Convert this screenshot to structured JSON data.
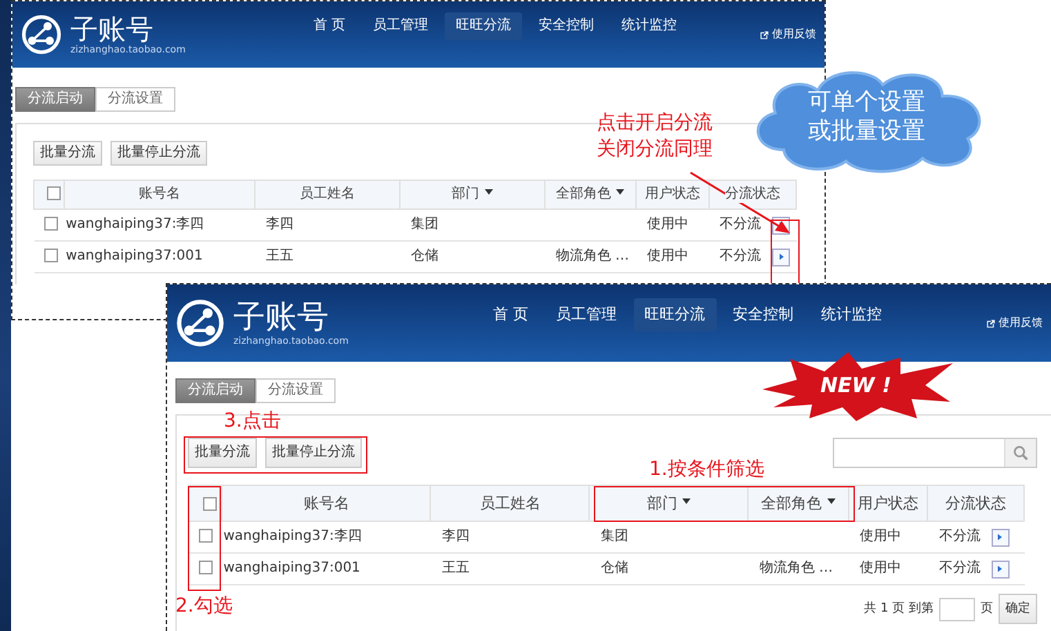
{
  "screens": [
    {
      "logo": {
        "title": "子账号",
        "subtitle": "zizhanghao.taobao.com"
      },
      "nav": [
        {
          "label": "首 页",
          "selected": false
        },
        {
          "label": "员工管理",
          "selected": false
        },
        {
          "label": "旺旺分流",
          "selected": true
        },
        {
          "label": "安全控制",
          "selected": false
        },
        {
          "label": "统计监控",
          "selected": false
        }
      ],
      "feedback": "使用反馈",
      "tabs": [
        {
          "label": "分流启动",
          "selected": true
        },
        {
          "label": "分流设置",
          "selected": false
        }
      ],
      "buttons": [
        "批量分流",
        "批量停止分流"
      ],
      "search": false,
      "table": {
        "header_checked": false,
        "columns": [
          {
            "label": "账号名",
            "dropdown": false
          },
          {
            "label": "员工姓名",
            "dropdown": false
          },
          {
            "label": "部门",
            "dropdown": true
          },
          {
            "label": "全部角色",
            "dropdown": true
          },
          {
            "label": "用户状态",
            "dropdown": false
          },
          {
            "label": "分流状态",
            "dropdown": false
          }
        ],
        "rows": [
          {
            "checked": false,
            "account": "wanghaiping37:李四",
            "name": "李四",
            "dept": "集团",
            "user_status": "使用中",
            "flow_status": "不分流"
          },
          {
            "checked": false,
            "account": "wanghaiping37:001",
            "name": "王五",
            "dept": "仓储",
            "role": "物流角色 …",
            "user_status": "使用中",
            "flow_status": "不分流"
          }
        ]
      }
    },
    {
      "logo": {
        "title": "子账号",
        "subtitle": "zizhanghao.taobao.com"
      },
      "nav": [
        {
          "label": "首 页",
          "selected": false
        },
        {
          "label": "员工管理",
          "selected": false
        },
        {
          "label": "旺旺分流",
          "selected": true
        },
        {
          "label": "安全控制",
          "selected": false
        },
        {
          "label": "统计监控",
          "selected": false
        }
      ],
      "feedback": "使用反馈",
      "tabs": [
        {
          "label": "分流启动",
          "selected": true
        },
        {
          "label": "分流设置",
          "selected": false
        }
      ],
      "buttons": [
        "批量分流",
        "批量停止分流"
      ],
      "search": true,
      "table": {
        "header_checked": false,
        "columns": [
          {
            "label": "账号名",
            "dropdown": false
          },
          {
            "label": "员工姓名",
            "dropdown": false
          },
          {
            "label": "部门",
            "dropdown": true
          },
          {
            "label": "全部角色",
            "dropdown": true
          },
          {
            "label": "用户状态",
            "dropdown": false
          },
          {
            "label": "分流状态",
            "dropdown": false
          }
        ],
        "rows": [
          {
            "checked": false,
            "account": "wanghaiping37:李四",
            "name": "李四",
            "dept": "集团",
            "user_status": "使用中",
            "flow_status": "不分流"
          },
          {
            "checked": false,
            "account": "wanghaiping37:001",
            "name": "王五",
            "dept": "仓储",
            "role": "物流角色 …",
            "user_status": "使用中",
            "flow_status": "不分流"
          }
        ]
      },
      "pagination": {
        "before": "共 1 页 到第",
        "after": "页",
        "button": "确定"
      }
    }
  ],
  "annotations": [
    {
      "kind": "note",
      "lines": [
        "点击开启分流",
        "关闭分流同理"
      ]
    },
    {
      "kind": "cloud",
      "lines": [
        "可单个设置",
        "或批量设置"
      ]
    },
    {
      "kind": "burst",
      "lines": [
        "NEW !"
      ]
    },
    {
      "kind": "note",
      "lines": [
        "3.点击"
      ]
    },
    {
      "kind": "note",
      "lines": [
        "1.按条件筛选"
      ]
    },
    {
      "kind": "note",
      "lines": [
        "2.勾选"
      ]
    }
  ]
}
